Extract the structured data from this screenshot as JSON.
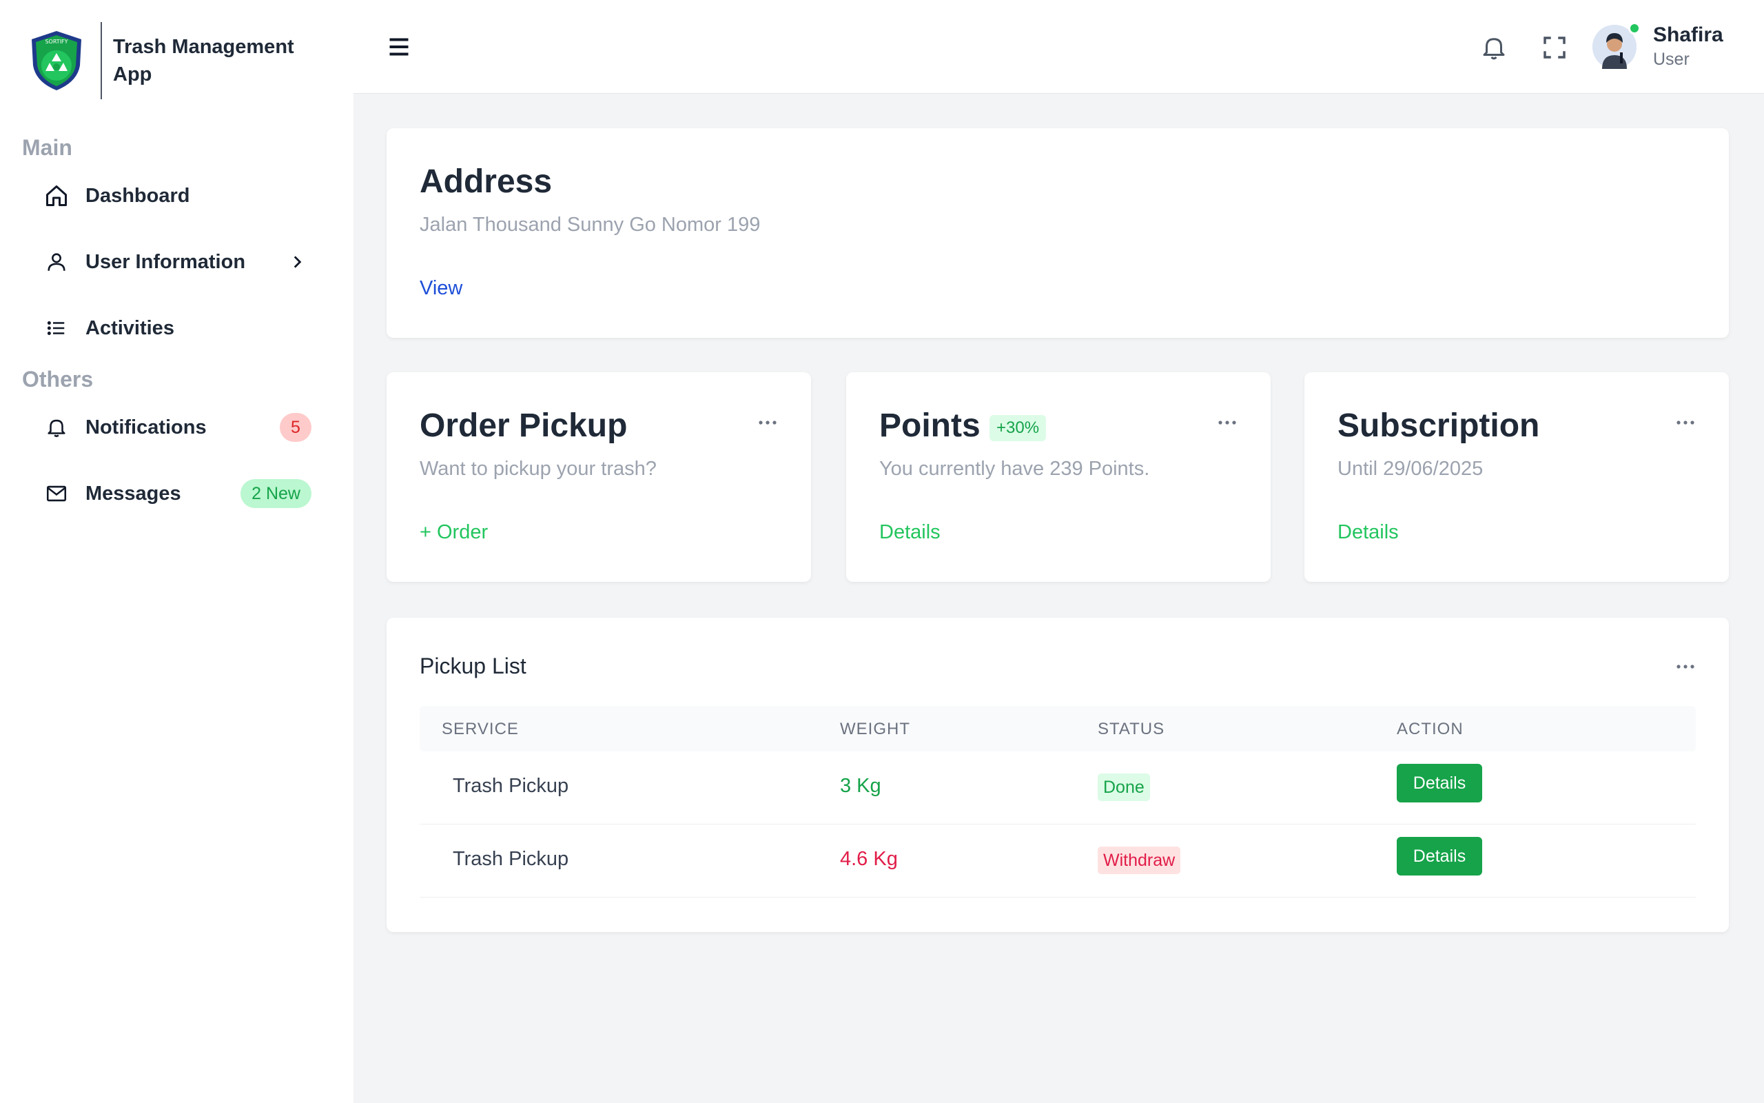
{
  "app": {
    "title": "Trash Management App",
    "logo_text": "SORTIFY"
  },
  "sidebar": {
    "sections": [
      "Main",
      "Others"
    ],
    "items": [
      {
        "label": "Dashboard",
        "icon": "home-icon"
      },
      {
        "label": "User Information",
        "icon": "user-icon"
      },
      {
        "label": "Activities",
        "icon": "list-icon"
      },
      {
        "label": "Notifications",
        "icon": "bell-icon",
        "badge": "5"
      },
      {
        "label": "Messages",
        "icon": "mail-icon",
        "badge": "2 New"
      }
    ]
  },
  "header": {
    "user_name": "Shafira",
    "user_role": "User",
    "icons": [
      "hamburger-icon",
      "bell-icon",
      "fullscreen-icon"
    ]
  },
  "address_card": {
    "title": "Address",
    "subtitle": "Jalan Thousand Sunny Go Nomor 199",
    "link": "View"
  },
  "order_card": {
    "title": "Order Pickup",
    "subtitle": "Want to pickup your trash?",
    "link": "+ Order"
  },
  "points_card": {
    "title": "Points",
    "badge": "+30%",
    "subtitle": "You currently have 239 Points.",
    "link": "Details"
  },
  "subscription_card": {
    "title": "Subscription",
    "subtitle": "Until 29/06/2025",
    "link": "Details"
  },
  "pickup_list": {
    "title": "Pickup List",
    "columns": [
      "SERVICE",
      "WEIGHT",
      "STATUS",
      "ACTION"
    ],
    "rows": [
      {
        "service": "Trash Pickup",
        "weight": "3 Kg",
        "status": "Done",
        "action": "Details"
      },
      {
        "service": "Trash Pickup",
        "weight": "4.6 Kg",
        "status": "Withdraw",
        "action": "Details"
      }
    ]
  },
  "colors": {
    "accent_green": "#16a34a",
    "link_green": "#22c55e",
    "link_blue": "#1d4ed8",
    "danger": "#e11d48",
    "background": "#f3f4f6"
  }
}
